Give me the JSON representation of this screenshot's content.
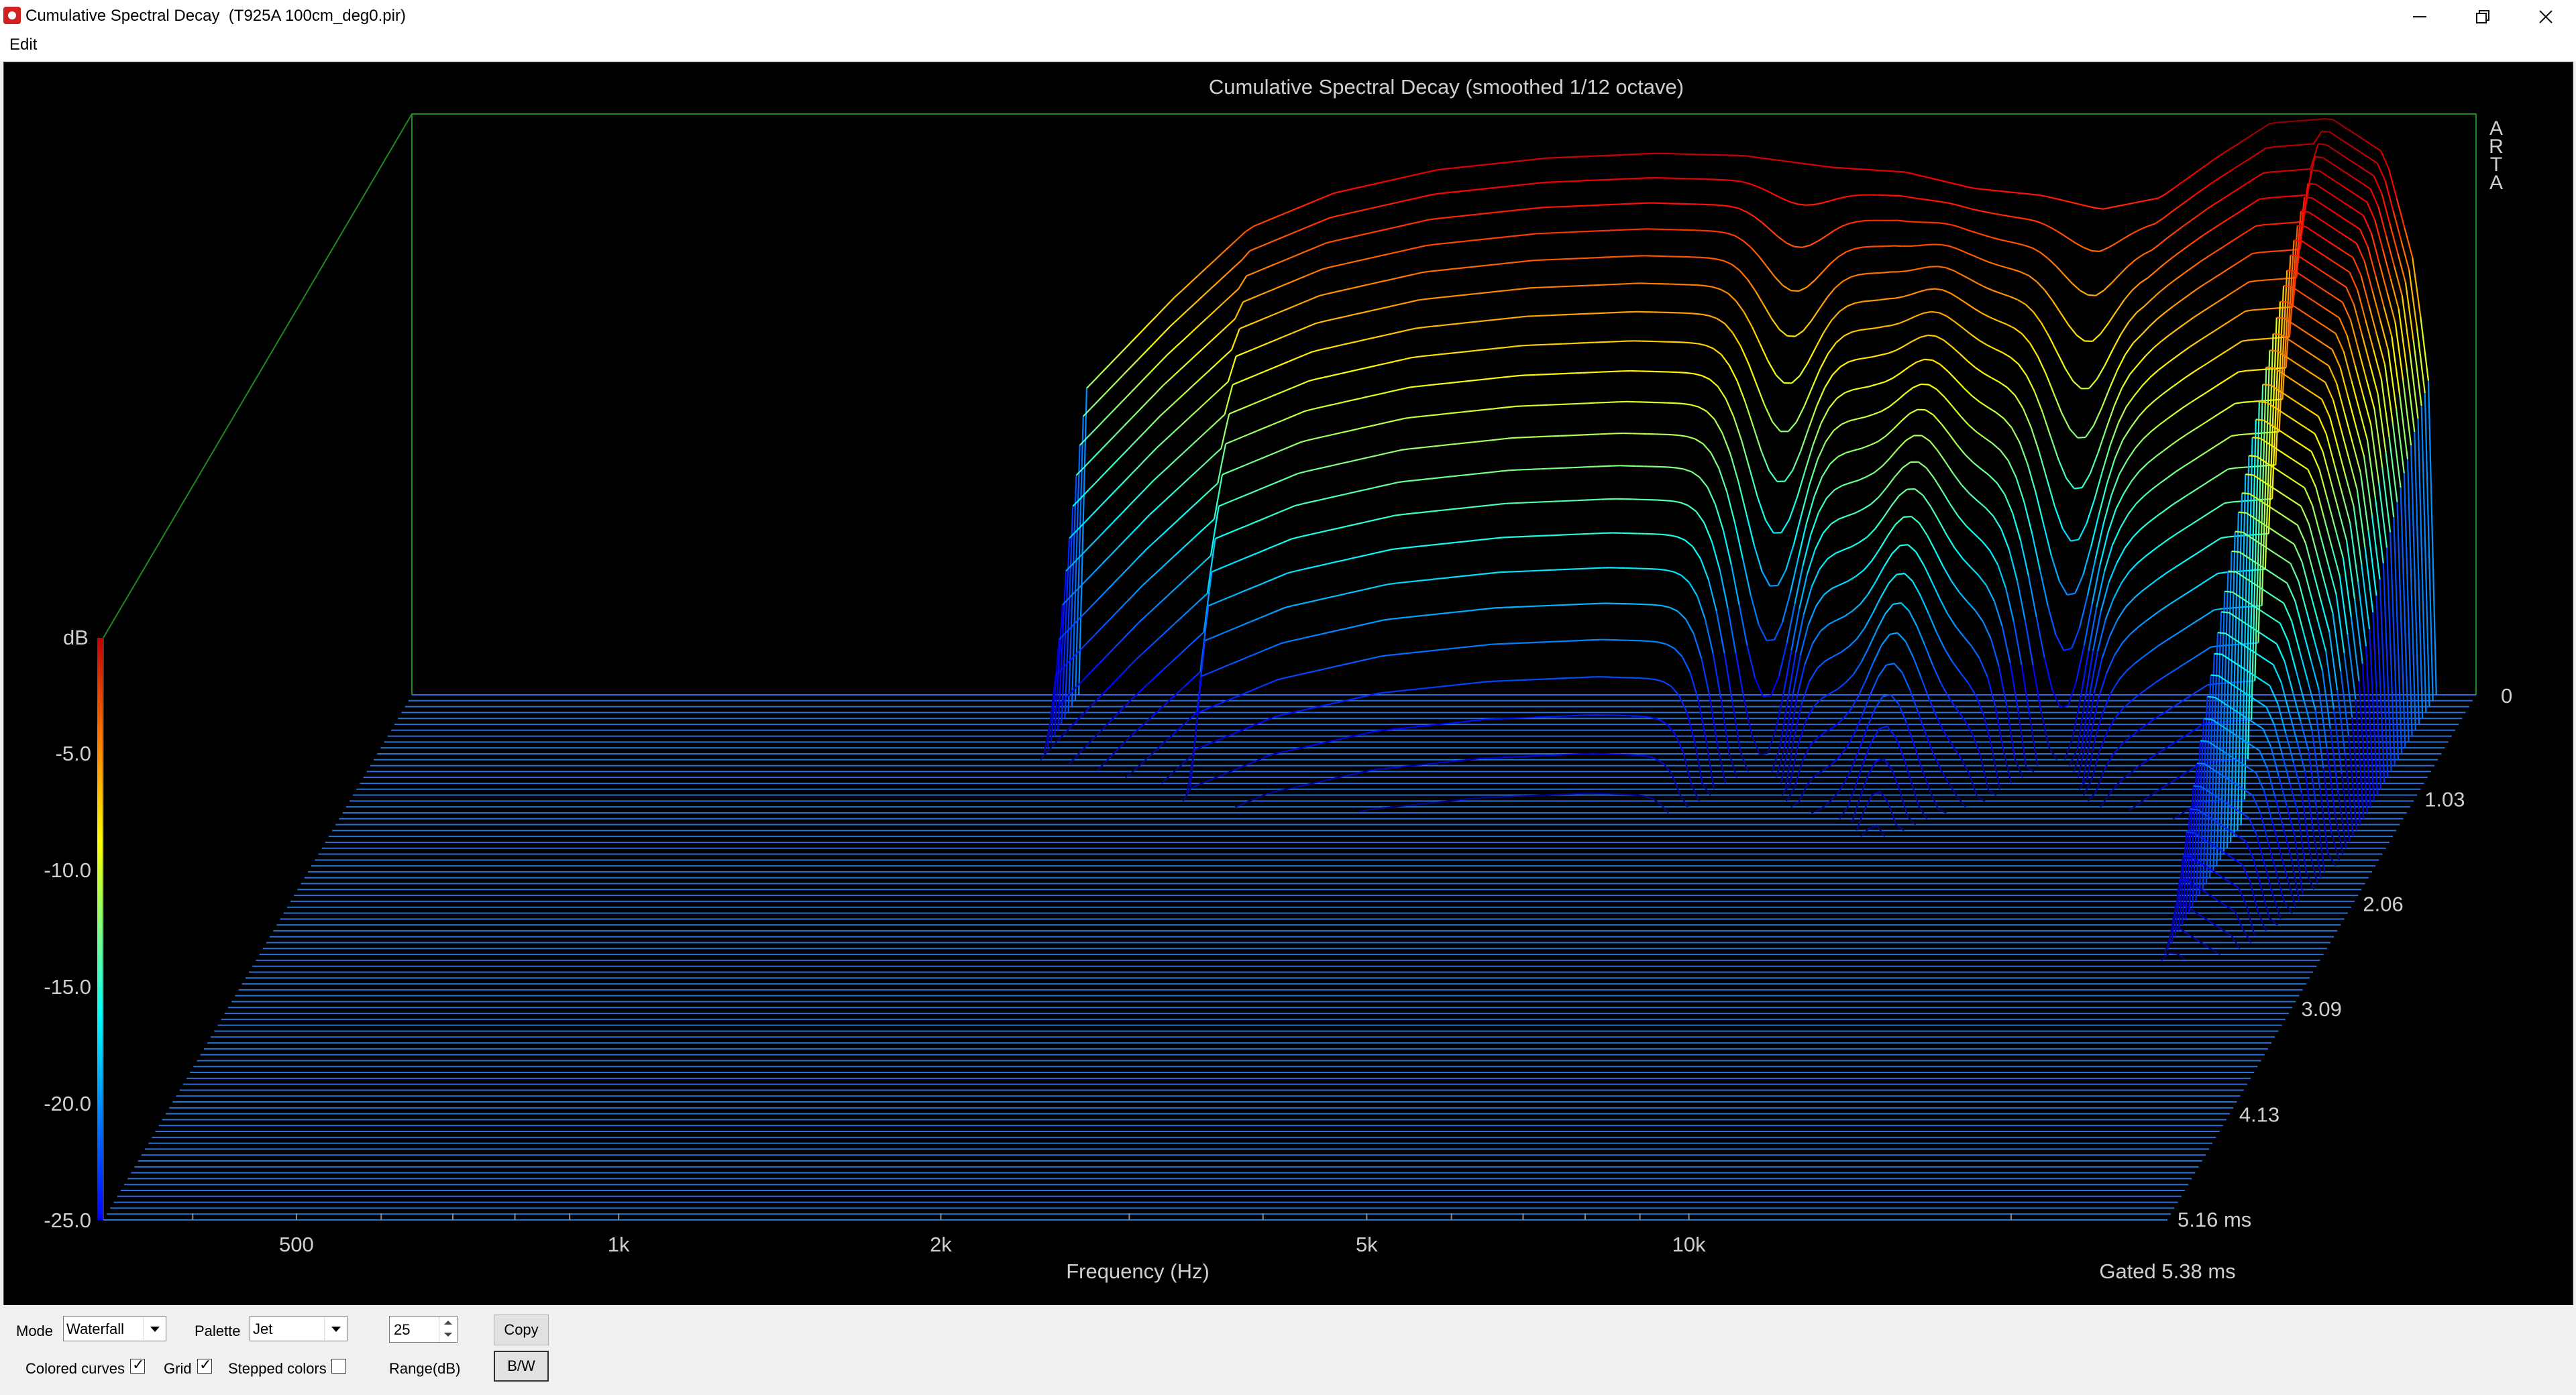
{
  "window": {
    "title": "Cumulative Spectral Decay  (T925A 100cm_deg0.pir)",
    "menu": [
      "Edit"
    ]
  },
  "chart_data": {
    "type": "waterfall",
    "title": "Cumulative Spectral Decay (smoothed 1/12 octave)",
    "watermark": "ARTA",
    "xlabel": "Frequency (Hz)",
    "x_scale": "log",
    "xlim": [
      330,
      28000
    ],
    "x_ticks": [
      {
        "value": 500,
        "label": "500"
      },
      {
        "value": 1000,
        "label": "1k"
      },
      {
        "value": 2000,
        "label": "2k"
      },
      {
        "value": 5000,
        "label": "5k"
      },
      {
        "value": 10000,
        "label": "10k"
      }
    ],
    "zlabel": "dB",
    "zlim": [
      -25,
      0
    ],
    "z_ticks": [
      "-5.0",
      "-10.0",
      "-15.0",
      "-20.0",
      "-25.0"
    ],
    "z_top_label": "0",
    "time_ms_ticks": [
      "1.03",
      "2.06",
      "3.09",
      "4.13",
      "5.16 ms"
    ],
    "time_range_ms": [
      0,
      5.16
    ],
    "gated_label": "Gated 5.38 ms",
    "palette": "Jet",
    "colors": {
      "background": "#000000",
      "frame": "#1e8a1e",
      "floor": "#2a6fd6",
      "text": "#cfcfcf"
    },
    "slice_count": 90,
    "response_profile": {
      "freq_hz": [
        1400,
        1700,
        2000,
        2400,
        3000,
        3800,
        4800,
        5800,
        7000,
        8200,
        9500,
        11000,
        12500,
        14200,
        16000,
        18000,
        20500,
        23000,
        24500,
        25500
      ],
      "level_db": [
        -12,
        -8,
        -5,
        -3.5,
        -2.5,
        -2.0,
        -1.8,
        -1.9,
        -2.4,
        -2.6,
        -3.3,
        -3.6,
        -4.2,
        -3.7,
        -2.0,
        -0.5,
        -0.3,
        -1.8,
        -6.5,
        -13
      ]
    },
    "decay_gaps": [
      {
        "freq_hz": 6600,
        "depth": 0.9
      },
      {
        "freq_hz": 12400,
        "depth": 1.0
      },
      {
        "freq_hz": 9200,
        "depth": -0.25
      }
    ]
  },
  "controls": {
    "mode_label": "Mode",
    "mode_value": "Waterfall",
    "palette_label": "Palette",
    "palette_value": "Jet",
    "range_value": "25",
    "range_label": "Range(dB)",
    "copy_label": "Copy",
    "bw_label": "B/W",
    "colored_curves_label": "Colored curves",
    "colored_curves": true,
    "grid_label": "Grid",
    "grid": true,
    "stepped_colors_label": "Stepped colors",
    "stepped_colors": false
  }
}
